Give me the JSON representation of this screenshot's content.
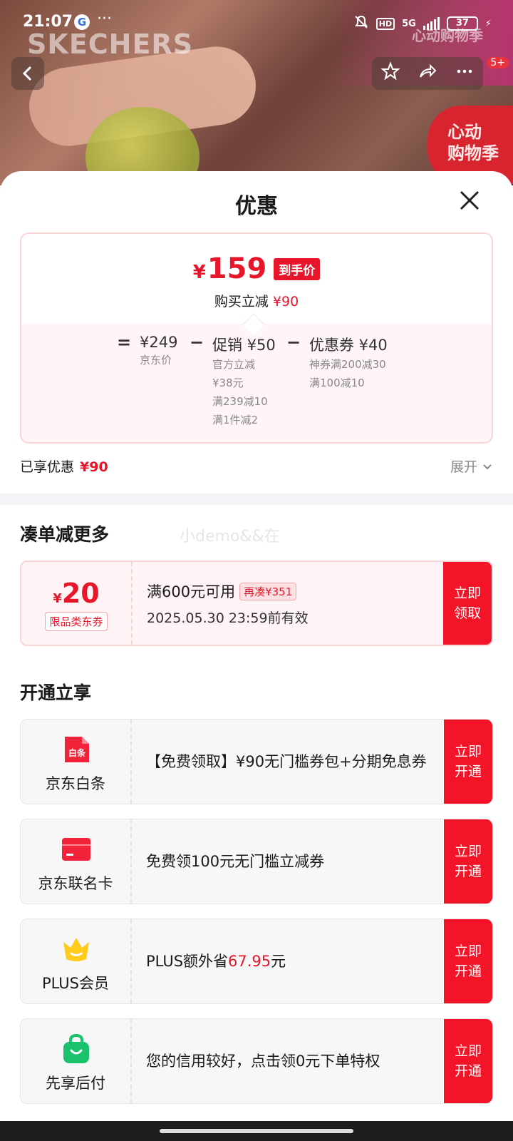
{
  "status_bar": {
    "time": "21:07",
    "g_label": "G",
    "network": "5G",
    "hd": "HD",
    "battery": "37"
  },
  "header": {
    "brand_watermark": "SKECHERS",
    "event_watermark": "心动购物季",
    "promo_badge_line1": "心动",
    "promo_badge_line2": "购物季",
    "cart_badge": "5+"
  },
  "sheet": {
    "title": "优惠",
    "final_price": "159",
    "currency": "¥",
    "price_tag": "到手价",
    "save_text": "购买立减",
    "save_amount": "¥90",
    "calc": {
      "equals": "=",
      "minus": "−",
      "jd_price": "¥249",
      "jd_price_label": "京东价",
      "promo_title": "促销 ¥50",
      "promo_sub1": "官方立减",
      "promo_sub2": "¥38元",
      "promo_sub3": "满239减10",
      "promo_sub4": "满1件减2",
      "coupon_title": "优惠券 ¥40",
      "coupon_sub1": "神券满200减30",
      "coupon_sub2": "满100减10"
    },
    "enjoyed_label": "已享优惠",
    "enjoyed_amount": "¥90",
    "expand_label": "展开"
  },
  "section_more": {
    "title": "凑单减更多",
    "watermark": "小demo&&在",
    "coupon": {
      "currency": "¥",
      "amount": "20",
      "type": "限品类东券",
      "condition": "满600元可用",
      "more_label": "再凑¥351",
      "valid_until": "2025.05.30 23:59前有效",
      "action": "立即\n领取"
    }
  },
  "section_open": {
    "title": "开通立享",
    "cards": [
      {
        "name": "京东白条",
        "icon": "baitiao-icon",
        "icon_text": "白条",
        "desc": "【免费领取】¥90无门槛券包+分期免息券",
        "action": "立即\n开通"
      },
      {
        "name": "京东联名卡",
        "icon": "credit-card-icon",
        "desc": "免费领100元无门槛立减券",
        "action": "立即\n开通"
      },
      {
        "name": "PLUS会员",
        "icon": "crown-icon",
        "desc_prefix": "PLUS额外省",
        "desc_amount": "67.95",
        "desc_suffix": "元",
        "action": "立即\n开通"
      },
      {
        "name": "先享后付",
        "icon": "shopping-bag-icon",
        "desc": "您的信用较好，点击领0元下单特权",
        "action": "立即\n开通"
      }
    ]
  },
  "colors": {
    "accent_red": "#e8162a",
    "button_red": "#f41428"
  }
}
